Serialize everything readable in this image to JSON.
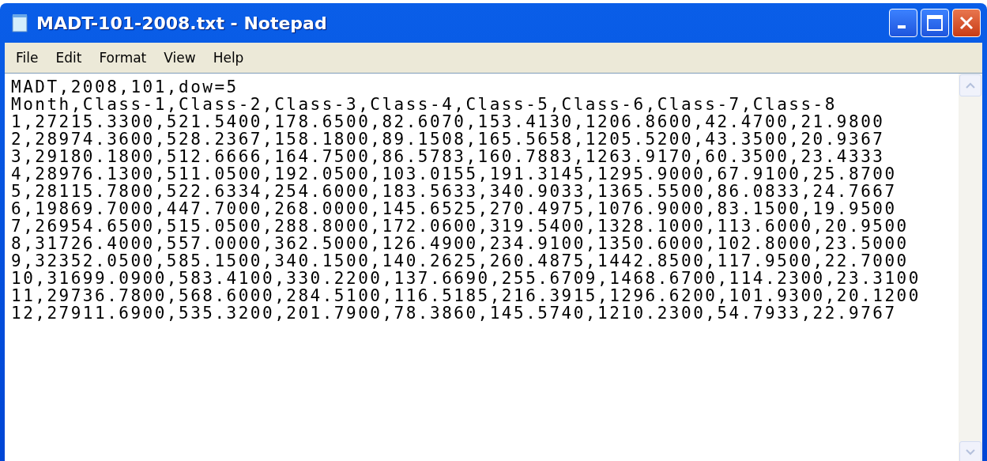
{
  "window": {
    "title": "MADT-101-2008.txt - Notepad"
  },
  "menu": [
    {
      "label": "File"
    },
    {
      "label": "Edit"
    },
    {
      "label": "Format"
    },
    {
      "label": "View"
    },
    {
      "label": "Help"
    }
  ],
  "document": {
    "lines": [
      "MADT,2008,101,dow=5",
      "Month,Class-1,Class-2,Class-3,Class-4,Class-5,Class-6,Class-7,Class-8",
      "1,27215.3300,521.5400,178.6500,82.6070,153.4130,1206.8600,42.4700,21.9800",
      "2,28974.3600,528.2367,158.1800,89.1508,165.5658,1205.5200,43.3500,20.9367",
      "3,29180.1800,512.6666,164.7500,86.5783,160.7883,1263.9170,60.3500,23.4333",
      "4,28976.1300,511.0500,192.0500,103.0155,191.3145,1295.9000,67.9100,25.8700",
      "5,28115.7800,522.6334,254.6000,183.5633,340.9033,1365.5500,86.0833,24.7667",
      "6,19869.7000,447.7000,268.0000,145.6525,270.4975,1076.9000,83.1500,19.9500",
      "7,26954.6500,515.0500,288.8000,172.0600,319.5400,1328.1000,113.6000,20.9500",
      "8,31726.4000,557.0000,362.5000,126.4900,234.9100,1350.6000,102.8000,23.5000",
      "9,32352.0500,585.1500,340.1500,140.2625,260.4875,1442.8500,117.9500,22.7000",
      "10,31699.0900,583.4100,330.2200,137.6690,255.6709,1468.6700,114.2300,23.3100",
      "11,29736.7800,568.6000,284.5100,116.5185,216.3915,1296.6200,101.9300,20.1200",
      "12,27911.6900,535.3200,201.7900,78.3860,145.5740,1210.2300,54.7933,22.9767"
    ]
  }
}
